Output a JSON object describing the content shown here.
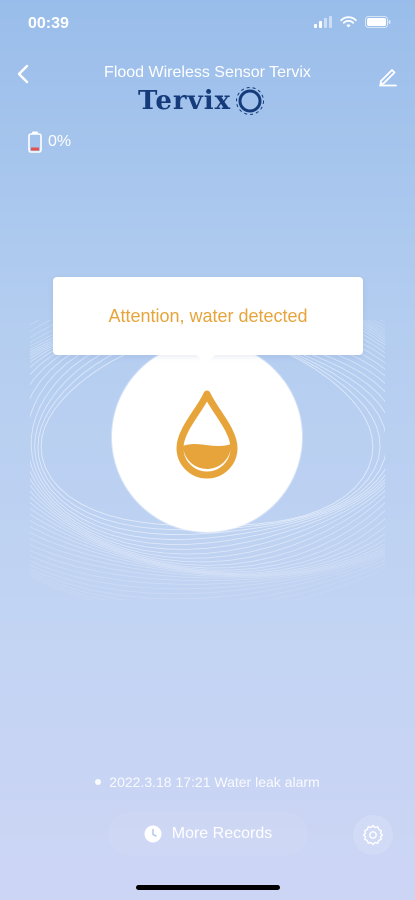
{
  "status_bar": {
    "time": "00:39",
    "icons": [
      "signal-icon",
      "wifi-icon",
      "battery-icon"
    ]
  },
  "header": {
    "title": "Flood Wireless Sensor Tervix",
    "logo_text": "Tervix",
    "back_icon": "chevron-left-icon",
    "edit_icon": "pencil-icon"
  },
  "device": {
    "battery_percent": "0%",
    "battery_icon": "battery-low-icon"
  },
  "alert": {
    "message": "Attention, water detected",
    "icon": "water-drop-icon"
  },
  "records": {
    "latest": "2022.3.18 17:21 Water leak alarm",
    "more_label": "More Records",
    "more_icon": "clock-icon"
  },
  "settings": {
    "icon": "gear-icon"
  },
  "colors": {
    "accent": "#e6a43a",
    "background_top": "#99bdea",
    "background_bottom": "#cdd5f5",
    "logo": "#163b7b"
  }
}
